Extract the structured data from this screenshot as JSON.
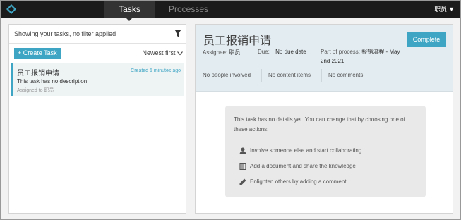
{
  "nav": {
    "tabs": [
      {
        "label": "Tasks",
        "active": true
      },
      {
        "label": "Processes",
        "active": false
      }
    ],
    "user_label": "职员"
  },
  "left": {
    "filter_text": "Showing your tasks, no filter applied",
    "create_label": "+ Create Task",
    "sort_label": "Newest first",
    "tasks": [
      {
        "title": "员工报销申请",
        "created": "Created 5 minutes ago",
        "description": "This task has no description",
        "assigned": "Assigned to 职员"
      }
    ]
  },
  "detail": {
    "title": "员工报销申请",
    "complete_label": "Complete",
    "assignee_label": "Assignee:",
    "assignee_value": "职员",
    "due_label": "Due:",
    "due_value": "No due date",
    "process_label": "Part of process:",
    "process_value": "报销流程 - May 2nd 2021",
    "people": "No people involved",
    "content": "No content items",
    "comments": "No comments",
    "empty_message": "This task has no details yet. You can change that by choosing one of these actions:",
    "actions": [
      {
        "icon": "person-icon",
        "label": "Involve someone else and start collaborating"
      },
      {
        "icon": "document-icon",
        "label": "Add a document and share the knowledge"
      },
      {
        "icon": "pencil-icon",
        "label": "Enlighten others by adding a comment"
      }
    ]
  },
  "colors": {
    "accent": "#3ea6c4",
    "topbar": "#1b1b1b",
    "header_bg": "#e3ecf1"
  }
}
